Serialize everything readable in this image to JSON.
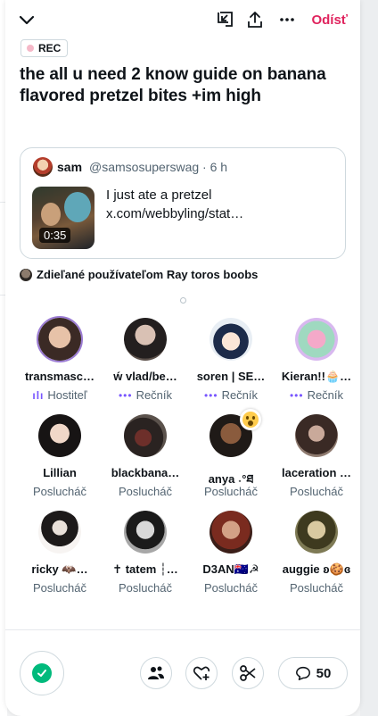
{
  "topbar": {
    "leave_label": "Odísť"
  },
  "space": {
    "rec_label": "REC",
    "title": "the all u need 2 know guide on banana flavored pretzel bites +im high"
  },
  "tweet": {
    "name": "sam",
    "handle": "@samsosuperswag · 6 h",
    "duration": "0:35",
    "text_line1": "I just ate a pretzel",
    "text_line2": "x.com/webbyling/stat…"
  },
  "shared_by": "Zdieľané používateľom Ray toros boobs",
  "participants": [
    {
      "name": "transmasc…",
      "role": "Hostiteľ"
    },
    {
      "name": "ẃ vlad/be…",
      "role": "Rečník"
    },
    {
      "name": "soren | SE…",
      "role": "Rečník"
    },
    {
      "name": "Kieran!!🧁…",
      "role": "Rečník"
    },
    {
      "name": "Lillian",
      "role": "Poslucháč"
    },
    {
      "name": "blackbana…",
      "role": "Poslucháč"
    },
    {
      "name": "anya ˖°ཐ",
      "role": "Poslucháč"
    },
    {
      "name": "laceration …",
      "role": "Poslucháč"
    },
    {
      "name": "ricky 🦇…",
      "role": "Poslucháč"
    },
    {
      "name": "✝ tatem ┆…",
      "role": "Poslucháč"
    },
    {
      "name": "D3AN🇦🇺☭",
      "role": "Poslucháč"
    },
    {
      "name": "auggie ʚ🍪ɞ",
      "role": "Poslucháč"
    }
  ],
  "footer": {
    "comment_count": "50"
  },
  "icons": {
    "back": "chevron-down-icon",
    "minimize": "minimize-icon",
    "share": "share-icon",
    "more": "more-icon",
    "mic": "check-icon",
    "people": "people-icon",
    "like": "heart-plus-icon",
    "clip": "scissors-icon",
    "comments": "comment-icon"
  },
  "colors": {
    "leave": "#e0245e",
    "accent": "#7856ff",
    "mic": "#00ba7c"
  }
}
